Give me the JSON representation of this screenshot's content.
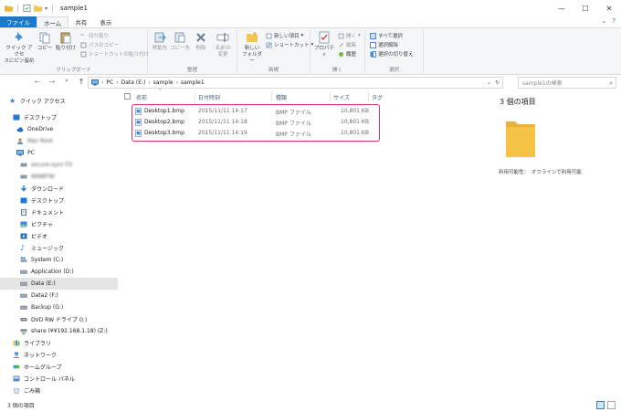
{
  "window": {
    "title": "sample1",
    "minimize": "—",
    "maximize": "☐",
    "close": "✕"
  },
  "ribbon_tabs": [
    {
      "label": "ファイル"
    },
    {
      "label": "ホーム"
    },
    {
      "label": "共有"
    },
    {
      "label": "表示"
    }
  ],
  "ribbon": {
    "clipboard": {
      "pin_label_1": "クイック アクセ",
      "pin_label_2": "スにピン留め",
      "copy": "コピー",
      "paste": "貼り付け",
      "cut": "切り取り",
      "copy_path": "パスのコピー",
      "paste_shortcut": "ショートカットの貼り付け",
      "group": "クリップボード"
    },
    "organize": {
      "move_to": "移動先",
      "copy_to": "コピー先",
      "delete": "削除",
      "rename_1": "名前の",
      "rename_2": "変更",
      "group": "整理"
    },
    "new": {
      "new_folder_1": "新しい",
      "new_folder_2": "フォルダー",
      "new_item": "新しい項目",
      "shortcut": "ショートカット",
      "group": "新規"
    },
    "open": {
      "properties": "プロパティ",
      "open": "開く",
      "edit": "編集",
      "history": "履歴",
      "group": "開く"
    },
    "select": {
      "select_all": "すべて選択",
      "select_none": "選択解除",
      "invert": "選択の切り替え",
      "group": "選択"
    }
  },
  "address": {
    "crumbs": [
      "PC",
      "Data (E:)",
      "sample",
      "sample1"
    ],
    "search_placeholder": "sample1の検索"
  },
  "nav": {
    "items": [
      {
        "label": "クイック アクセス"
      },
      {
        "label": "デスクトップ"
      },
      {
        "label": "OneDrive"
      },
      {
        "label": "Mac Root"
      },
      {
        "label": "PC"
      },
      {
        "label": "secure-sync-TX"
      },
      {
        "label": "WIN8TW"
      },
      {
        "label": "ダウンロード"
      },
      {
        "label": "デスクトップ"
      },
      {
        "label": "ドキュメント"
      },
      {
        "label": "ピクチャ"
      },
      {
        "label": "ビデオ"
      },
      {
        "label": "ミュージック"
      },
      {
        "label": "System (C:)"
      },
      {
        "label": "Application (D:)"
      },
      {
        "label": "Data (E:)"
      },
      {
        "label": "Data2 (F:)"
      },
      {
        "label": "Backup (G:)"
      },
      {
        "label": "DVD RW ドライブ (I:)"
      },
      {
        "label": "share (¥¥192.168.1.18) (Z:)"
      },
      {
        "label": "ライブラリ"
      },
      {
        "label": "ネットワーク"
      },
      {
        "label": "ホームグループ"
      },
      {
        "label": "コントロール パネル"
      },
      {
        "label": "ごみ箱"
      }
    ]
  },
  "columns": {
    "name": "名前",
    "date": "日付時刻",
    "type": "種類",
    "size": "サイズ",
    "tag": "タグ"
  },
  "files": [
    {
      "name": "Desktop1.bmp",
      "date": "2015/11/11 14:17",
      "type": "BMP ファイル",
      "size": "10,801 KB"
    },
    {
      "name": "Desktop2.bmp",
      "date": "2015/11/11 14:18",
      "type": "BMP ファイル",
      "size": "10,801 KB"
    },
    {
      "name": "Desktop3.bmp",
      "date": "2015/11/11 14:19",
      "type": "BMP ファイル",
      "size": "10,801 KB"
    }
  ],
  "details": {
    "title": "3 個の項目",
    "availability": "利用可能性：　オフラインで利用可能"
  },
  "status": {
    "count": "3 個の項目"
  },
  "colors": {
    "file_tab": "#1979ca",
    "selection": "#cce8ff",
    "highlight_border": "#e0306a",
    "folder": "#f6c445"
  }
}
